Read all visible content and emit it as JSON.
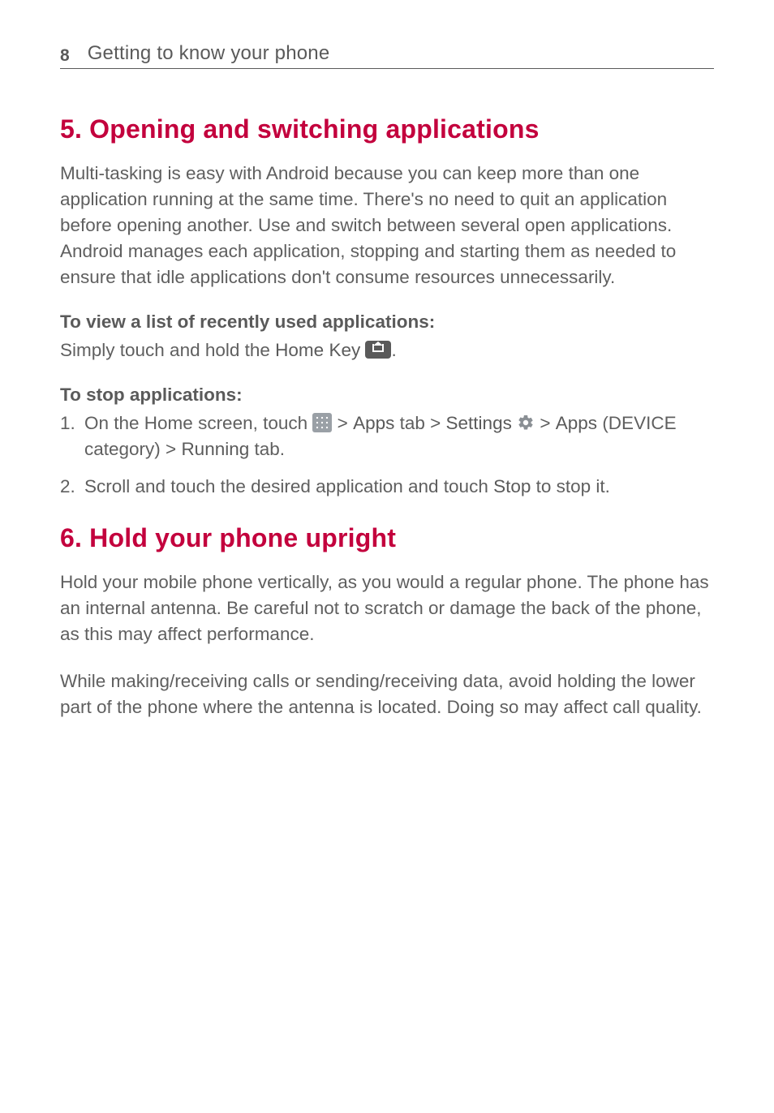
{
  "header": {
    "page_number": "8",
    "section": "Getting to know your phone"
  },
  "sections": {
    "s5": {
      "title": "5. Opening and switching applications",
      "intro": "Multi-tasking is easy with Android because you can keep more than one application running at the same time. There's no need to quit an application before opening another. Use and switch between several open applications. Android manages each application, stopping and starting them as needed to ensure that idle applications don't consume resources unnecessarily.",
      "recent_heading": "To view a list of recently used applications:",
      "recent_line_pre": "Simply touch and hold the ",
      "recent_home_key": "Home Key",
      "recent_line_post": ".",
      "stop_heading": "To stop applications:",
      "step1": {
        "num": "1.",
        "pre": "On the Home screen, touch ",
        "apps_tab": "Apps",
        "tab_word": " tab > ",
        "settings": "Settings",
        "gt2": "  > ",
        "apps2": "Apps",
        "device_line": " (DEVICE category) > ",
        "running": "Running",
        "tab_end": " tab.",
        "gt1": " > "
      },
      "step2": {
        "num": "2.",
        "pre": "Scroll and touch the desired application and touch ",
        "stop": "Stop",
        "post": " to stop it."
      }
    },
    "s6": {
      "title": "6. Hold your phone upright",
      "p1": "Hold your mobile phone vertically, as you would a regular phone. The phone has an internal antenna. Be careful not to scratch or damage the back of the phone, as this may affect performance.",
      "p2": "While making/receiving calls or sending/receiving data, avoid holding the lower part of the phone where the antenna is located. Doing so may affect call quality."
    }
  }
}
